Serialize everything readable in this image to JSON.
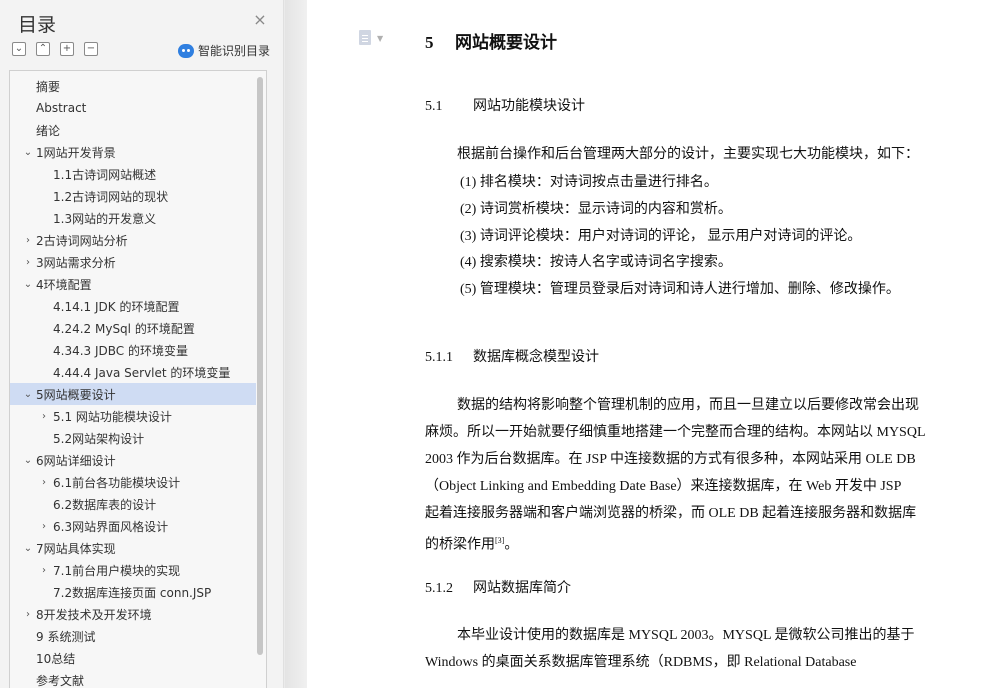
{
  "sidebar": {
    "title": "目录",
    "close_label": "×",
    "tools": [
      "⌄",
      "⌃",
      "+",
      "−"
    ],
    "smart_label": "智能识别目录",
    "items": [
      {
        "label": "摘要",
        "level": 0,
        "caret": "",
        "selected": false
      },
      {
        "label": "Abstract",
        "level": 0,
        "caret": "",
        "selected": false
      },
      {
        "label": "绪论",
        "level": 0,
        "caret": "",
        "selected": false
      },
      {
        "label": "1网站开发背景",
        "level": 0,
        "caret": "⌄",
        "selected": false
      },
      {
        "label": "1.1古诗词网站概述",
        "level": 1,
        "caret": "",
        "selected": false
      },
      {
        "label": "1.2古诗词网站的现状",
        "level": 1,
        "caret": "",
        "selected": false
      },
      {
        "label": "1.3网站的开发意义",
        "level": 1,
        "caret": "",
        "selected": false
      },
      {
        "label": "2古诗词网站分析",
        "level": 0,
        "caret": "›",
        "selected": false
      },
      {
        "label": "3网站需求分析",
        "level": 0,
        "caret": "›",
        "selected": false
      },
      {
        "label": "4环境配置",
        "level": 0,
        "caret": "⌄",
        "selected": false
      },
      {
        "label": "4.14.1 JDK 的环境配置",
        "level": 1,
        "caret": "",
        "selected": false
      },
      {
        "label": "4.24.2 MySql 的环境配置",
        "level": 1,
        "caret": "",
        "selected": false
      },
      {
        "label": "4.34.3 JDBC 的环境变量",
        "level": 1,
        "caret": "",
        "selected": false
      },
      {
        "label": "4.44.4 Java Servlet 的环境变量",
        "level": 1,
        "caret": "",
        "selected": false
      },
      {
        "label": "5网站概要设计",
        "level": 0,
        "caret": "⌄",
        "selected": true
      },
      {
        "label": "5.1  网站功能模块设计",
        "level": 1,
        "caret": "›",
        "selected": false
      },
      {
        "label": "5.2网站架构设计",
        "level": 1,
        "caret": "",
        "selected": false
      },
      {
        "label": "6网站详细设计",
        "level": 0,
        "caret": "⌄",
        "selected": false
      },
      {
        "label": "6.1前台各功能模块设计",
        "level": 1,
        "caret": "›",
        "selected": false
      },
      {
        "label": "6.2数据库表的设计",
        "level": 1,
        "caret": "",
        "selected": false
      },
      {
        "label": "6.3网站界面风格设计",
        "level": 1,
        "caret": "›",
        "selected": false
      },
      {
        "label": "7网站具体实现",
        "level": 0,
        "caret": "⌄",
        "selected": false
      },
      {
        "label": "7.1前台用户模块的实现",
        "level": 1,
        "caret": "›",
        "selected": false
      },
      {
        "label": "7.2数据库连接页面 conn.JSP",
        "level": 1,
        "caret": "",
        "selected": false
      },
      {
        "label": "8开发技术及开发环境",
        "level": 0,
        "caret": "›",
        "selected": false
      },
      {
        "label": "9 系统测试",
        "level": 0,
        "caret": "",
        "selected": false
      },
      {
        "label": "10总结",
        "level": 0,
        "caret": "",
        "selected": false
      },
      {
        "label": "参考文献",
        "level": 0,
        "caret": "",
        "selected": false
      }
    ]
  },
  "document": {
    "h1_num": "5",
    "h1_text": "网站概要设计",
    "s51_num": "5.1",
    "s51_text": "网站功能模块设计",
    "intro": "根据前台操作和后台管理两大部分的设计，主要实现七大功能模块，如下：",
    "list": [
      "(1)  排名模块：对诗词按点击量进行排名。",
      "(2)  诗词赏析模块：显示诗词的内容和赏析。",
      "(3)  诗词评论模块：用户对诗词的评论，  显示用户对诗词的评论。",
      "(4)  搜索模块：按诗人名字或诗词名字搜索。",
      "(5)  管理模块：管理员登录后对诗词和诗人进行增加、删除、修改操作。"
    ],
    "s511_num": "5.1.1",
    "s511_text": "数据库概念模型设计",
    "p511_lines": [
      "数据的结构将影响整个管理机制的应用，而且一旦建立以后要修改常会出现",
      "麻烦。所以一开始就要仔细慎重地搭建一个完整而合理的结构。本网站以 MYSQL",
      "2003 作为后台数据库。在 JSP 中连接数据的方式有很多种，本网站采用 OLE DB",
      "（Object Linking and Embedding Date Base）来连接数据库，在 Web 开发中 JSP",
      "起着连接服务器端和客户端浏览器的桥梁，而 OLE DB 起着连接服务器和数据库"
    ],
    "p511_last": "的桥梁作用",
    "p511_ref": "[3]",
    "p511_end": "。",
    "s512_num": "5.1.2",
    "s512_text": "网站数据库简介",
    "p512_line1": "本毕业设计使用的数据库是 MYSQL 2003。MYSQL 是微软公司推出的基于",
    "p512_line2": "Windows 的桌面关系数据库管理系统（RDBMS，即 Relational Database"
  }
}
